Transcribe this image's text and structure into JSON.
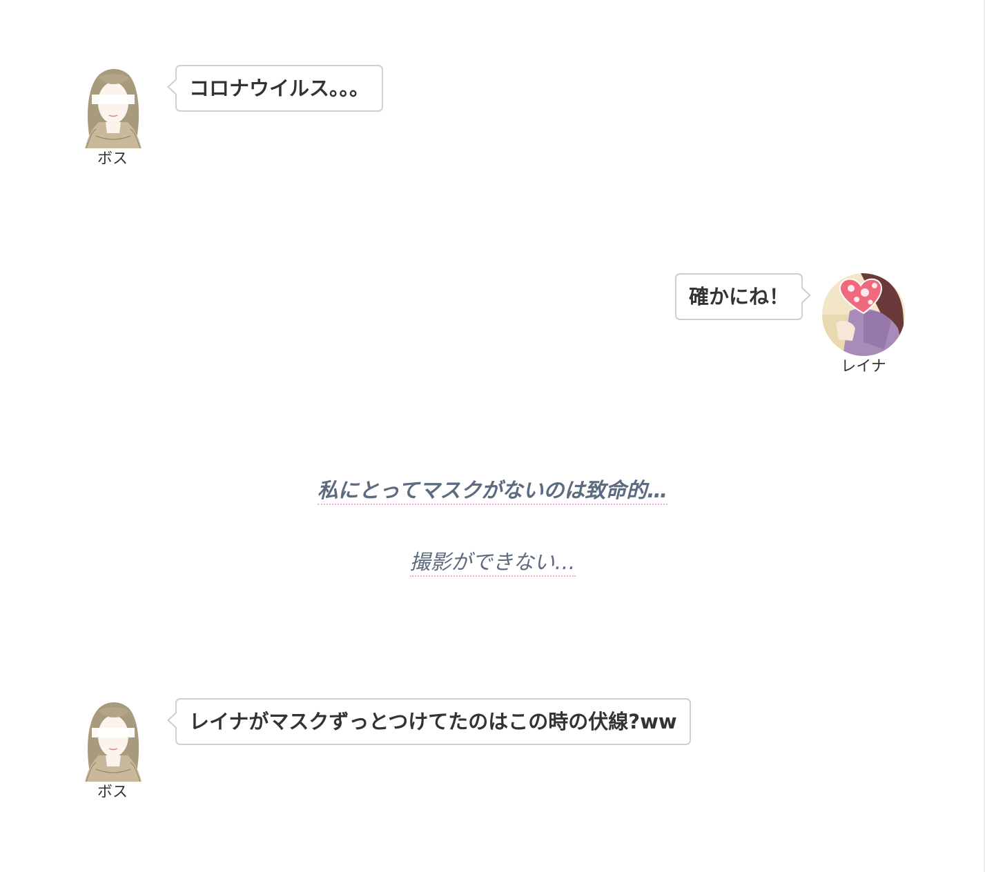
{
  "messages": [
    {
      "speaker": "ボス",
      "text": "コロナウイルス。。。"
    },
    {
      "speaker": "レイナ",
      "text": "確かにね！"
    },
    {
      "speaker": "ボス",
      "text": "レイナがマスクずっとつけてたのはこの時の伏線?ww"
    }
  ],
  "narration": [
    {
      "text": "私にとってマスクがないのは致命的…"
    },
    {
      "text": "撮影ができない…"
    }
  ],
  "colors": {
    "bubble_border": "#cfcfcf",
    "narration_text": "#5c6b80",
    "narration_underline": "#f0a8d4"
  }
}
